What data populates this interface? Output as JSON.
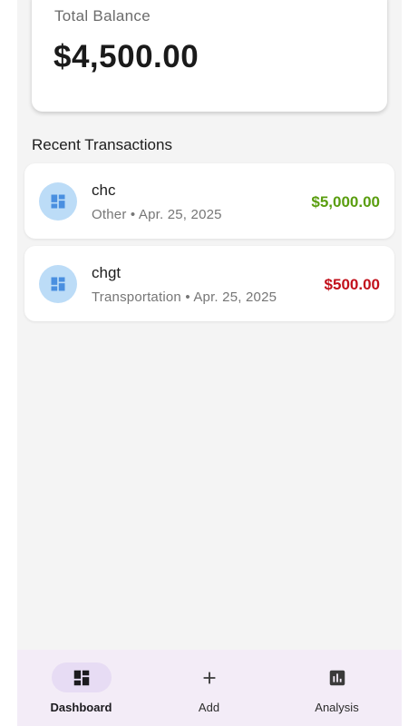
{
  "balance": {
    "label": "Total Balance",
    "amount": "$4,500.00"
  },
  "recent": {
    "title": "Recent Transactions",
    "items": [
      {
        "name": "chc",
        "meta": "Other • Apr. 25, 2025",
        "amount": "$5,000.00",
        "type": "income",
        "amount_color": "#5a9e0f",
        "icon": "dashboard-icon"
      },
      {
        "name": "chgt",
        "meta": "Transportation • Apr. 25, 2025",
        "amount": "$500.00",
        "type": "expense",
        "amount_color": "#c2101b",
        "icon": "dashboard-icon"
      }
    ]
  },
  "nav": {
    "items": [
      {
        "label": "Dashboard",
        "icon": "dashboard-icon",
        "active": true
      },
      {
        "label": "Add",
        "icon": "plus-icon",
        "active": false
      },
      {
        "label": "Analysis",
        "icon": "bar-chart-icon",
        "active": false
      }
    ]
  },
  "colors": {
    "background": "#f4f4f4",
    "nav_background": "#f3ecf7",
    "nav_active_pill": "#e7dcf4",
    "icon_circle": "#bcdcf7",
    "icon_fill": "#4a8fe0"
  }
}
